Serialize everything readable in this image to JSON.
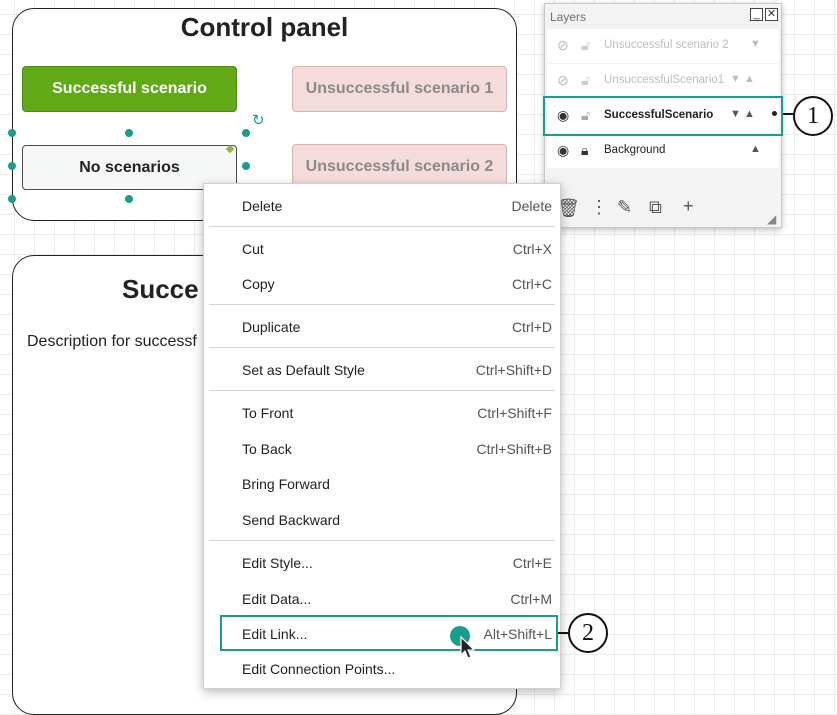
{
  "control_panel": {
    "title": "Control panel",
    "buttons": {
      "successful": "Successful scenario",
      "unsuccessful1": "Unsuccessful scenario 1",
      "no_scenarios": "No scenarios",
      "unsuccessful2": "Unsuccessful scenario 2"
    }
  },
  "successful_panel": {
    "title": "Successful",
    "title_visible": "Succe",
    "description": "Description for successful scenario",
    "description_visible": "Description for successf"
  },
  "layers": {
    "title": "Layers",
    "rows": [
      {
        "name": "Unsuccessful scenario 2",
        "hidden": true,
        "arrows": "▼"
      },
      {
        "name": "UnsuccessfulScenario1",
        "hidden": true,
        "arrows": "▼ ▲"
      },
      {
        "name": "SuccessfulScenario",
        "hidden": false,
        "selected": true,
        "arrows": "▼ ▲"
      },
      {
        "name": "Background",
        "hidden": false,
        "arrows": "▲"
      }
    ],
    "callout_label": "1"
  },
  "context_menu": {
    "items": [
      {
        "label": "Delete",
        "shortcut": "Delete"
      },
      {
        "label": "Cut",
        "shortcut": "Ctrl+X"
      },
      {
        "label": "Copy",
        "shortcut": "Ctrl+C"
      },
      {
        "label": "Duplicate",
        "shortcut": "Ctrl+D"
      },
      {
        "label": "Set as Default Style",
        "shortcut": "Ctrl+Shift+D"
      },
      {
        "label": "To Front",
        "shortcut": "Ctrl+Shift+F"
      },
      {
        "label": "To Back",
        "shortcut": "Ctrl+Shift+B"
      },
      {
        "label": "Bring Forward",
        "shortcut": ""
      },
      {
        "label": "Send Backward",
        "shortcut": ""
      },
      {
        "label": "Edit Style...",
        "shortcut": "Ctrl+E"
      },
      {
        "label": "Edit Data...",
        "shortcut": "Ctrl+M"
      },
      {
        "label": "Edit Link...",
        "shortcut": "Alt+Shift+L"
      },
      {
        "label": "Edit Connection Points...",
        "shortcut": ""
      }
    ],
    "callout_label": "2"
  },
  "colors": {
    "accent_teal": "#1a9e8c",
    "success_green": "#60a917",
    "unsuccessful_pink": "#f4dcdc"
  }
}
